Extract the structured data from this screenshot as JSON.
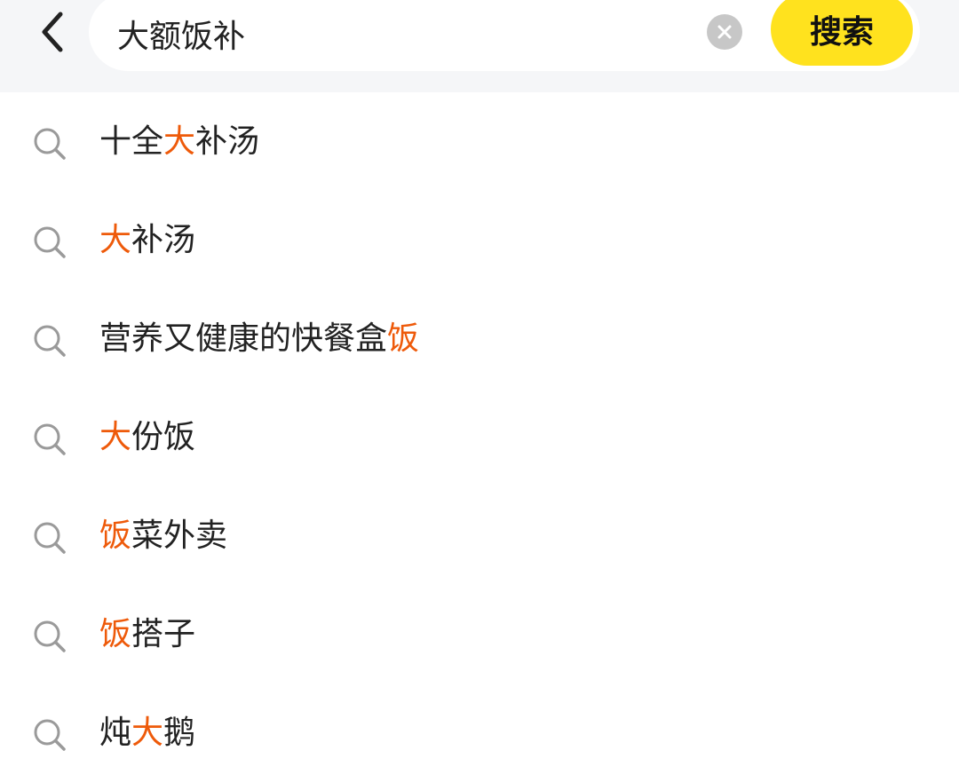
{
  "search": {
    "value": "大额饭补",
    "button_label": "搜索"
  },
  "colors": {
    "accent": "#ffe21e",
    "highlight": "#ee5a0a"
  },
  "icons": {
    "back": "back-arrow-icon",
    "clear": "clear-circle-icon",
    "suggestion": "search-icon"
  },
  "suggestions": [
    {
      "parts": [
        {
          "t": "十全",
          "h": false
        },
        {
          "t": "大",
          "h": true
        },
        {
          "t": "补汤",
          "h": false
        }
      ]
    },
    {
      "parts": [
        {
          "t": "大",
          "h": true
        },
        {
          "t": "补汤",
          "h": false
        }
      ]
    },
    {
      "parts": [
        {
          "t": "营养又健康的快餐盒",
          "h": false
        },
        {
          "t": "饭",
          "h": true
        }
      ]
    },
    {
      "parts": [
        {
          "t": "大",
          "h": true
        },
        {
          "t": "份饭",
          "h": false
        }
      ]
    },
    {
      "parts": [
        {
          "t": "饭",
          "h": true
        },
        {
          "t": "菜外卖",
          "h": false
        }
      ]
    },
    {
      "parts": [
        {
          "t": "饭",
          "h": true
        },
        {
          "t": "搭子",
          "h": false
        }
      ]
    },
    {
      "parts": [
        {
          "t": "炖",
          "h": false
        },
        {
          "t": "大",
          "h": true
        },
        {
          "t": "鹅",
          "h": false
        }
      ]
    }
  ]
}
